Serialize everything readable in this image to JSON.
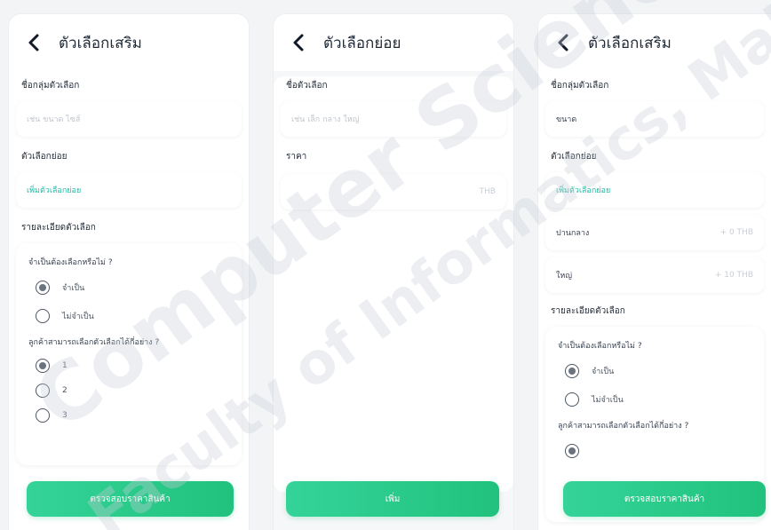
{
  "screen1": {
    "title": "ตัวเลือกเสริม",
    "group_name_label": "ชื่อกลุ่มตัวเลือก",
    "group_name_placeholder": "เช่น ขนาด ไซส์",
    "sub_options_label": "ตัวเลือกย่อย",
    "add_sub_option": "เพิ่มตัวเลือกย่อย",
    "details_label": "รายละเอียดตัวเลือก",
    "required_question": "จำเป็นต้องเลือกหรือไม่ ?",
    "required_yes": "จำเป็น",
    "required_no": "ไม่จำเป็น",
    "count_question": "ลูกค้าสามารถเลือกตัวเลือกได้กี่อย่าง ?",
    "count_options": [
      "1",
      "2",
      "3"
    ],
    "submit_button": "ตรวจสอบราคาสินค้า"
  },
  "screen2": {
    "title": "ตัวเลือกย่อย",
    "option_name_label": "ชื่อตัวเลือก",
    "option_name_placeholder": "เช่น เล็ก กลาง ใหญ่",
    "price_label": "ราคา",
    "price_suffix": "THB",
    "add_button": "เพิ่ม"
  },
  "screen3": {
    "title": "ตัวเลือกเสริม",
    "group_name_label": "ชื่อกลุ่มตัวเลือก",
    "group_name_value": "ขนาด",
    "sub_options_label": "ตัวเลือกย่อย",
    "add_sub_option": "เพิ่มตัวเลือกย่อย",
    "sub_options": [
      {
        "name": "ปานกลาง",
        "price": "+ 0 THB"
      },
      {
        "name": "ใหญ่",
        "price": "+ 10 THB"
      }
    ],
    "details_label": "รายละเอียดตัวเลือก",
    "required_question": "จำเป็นต้องเลือกหรือไม่ ?",
    "required_yes": "จำเป็น",
    "required_no": "ไม่จำเป็น",
    "count_question": "ลูกค้าสามารถเลือกตัวเลือกได้กี่อย่าง ?",
    "submit_button": "ตรวจสอบราคาสินค้า"
  },
  "watermark": {
    "line1": "Computer Science,",
    "line2": "Faculty of Informatics, Maha"
  },
  "colors": {
    "accent": "#22b8a3",
    "button_start": "#34d399",
    "button_end": "#21c27d"
  }
}
